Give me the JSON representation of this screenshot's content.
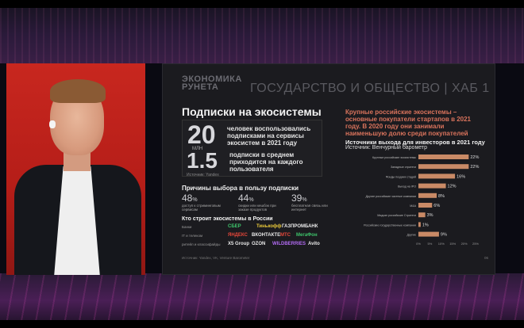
{
  "slide": {
    "brand_line1": "ЭКОНОМИКА",
    "brand_line2": "РУНЕТА",
    "header_title": "ГОСУДАРСТВО И ОБЩЕСТВО | ХАБ 1",
    "subscriptions_heading": "Подписки на экосистемы",
    "stat1_value": "20",
    "stat1_unit": "МЛН",
    "stat1_desc": "человек воспользовались подписками на сервисы экосистем в 2021 году",
    "stat2_value": "1.5",
    "stat2_desc": "подписки в среднем приходится на каждого пользователя",
    "stat_source": "Источник: Yandex",
    "reasons_heading": "Причины выбора в пользу подписки",
    "reasons": [
      {
        "pct": "48",
        "suffix": "%",
        "label": "доступ к стриминговым сервисам"
      },
      {
        "pct": "44",
        "suffix": "%",
        "label": "скидки или кешбэк при заказе продуктов"
      },
      {
        "pct": "39",
        "suffix": "%",
        "label": "бесплатная связь или интернет"
      }
    ],
    "ecosystems_heading": "Кто строит экосистемы в России",
    "eco_rows": [
      "Банки",
      "IT и телеком",
      "ритейл и классифайды"
    ],
    "logos": {
      "sber": "СБЕР",
      "tinkoff": "Тинькофф",
      "gazprombank": "ГАЗПРОМБАНК",
      "yandex": "ЯНДЕКС",
      "vk": "ВКОНТАКТЕ",
      "mts": "МТС",
      "megafon": "МегаФон",
      "x5": "X5 Group",
      "ozon": "OZON",
      "wildberries": "WILDBERRIES",
      "avito": "Avito"
    },
    "footer_source": "Источник: Yandex, VK, Venture Barometer",
    "page_number": "06",
    "orange_note": "Крупные российские экосистемы – основные покупатели стартапов в 2021 году. В 2020 году они занимали наименьшую долю среди покупателей",
    "chart_title": "Источники выхода для инвесторов в 2021 году",
    "chart_subtitle": "Источник: Венчурный барометр"
  },
  "colors": {
    "bar": "#c98a66",
    "accent": "#d9735c"
  },
  "chart_data": {
    "type": "bar",
    "orientation": "horizontal",
    "categories": [
      "Крупные российские экосистемы",
      "Западные стратеги",
      "Фонды поздних стадий",
      "Выход на IPO",
      "Другие российские частные компании",
      "M&A",
      "Мидкап российские Стратеги",
      "Российские государственные компании",
      "Другие"
    ],
    "values": [
      22,
      22,
      16,
      12,
      8,
      6,
      3,
      1,
      9
    ],
    "value_labels": [
      "22%",
      "22%",
      "16%",
      "12%",
      "8%",
      "6%",
      "3%",
      "1%",
      "9%"
    ],
    "xlim": [
      0,
      25
    ],
    "xticks": [
      "0%",
      "5%",
      "10%",
      "15%",
      "20%",
      "25%"
    ],
    "grid": false
  }
}
